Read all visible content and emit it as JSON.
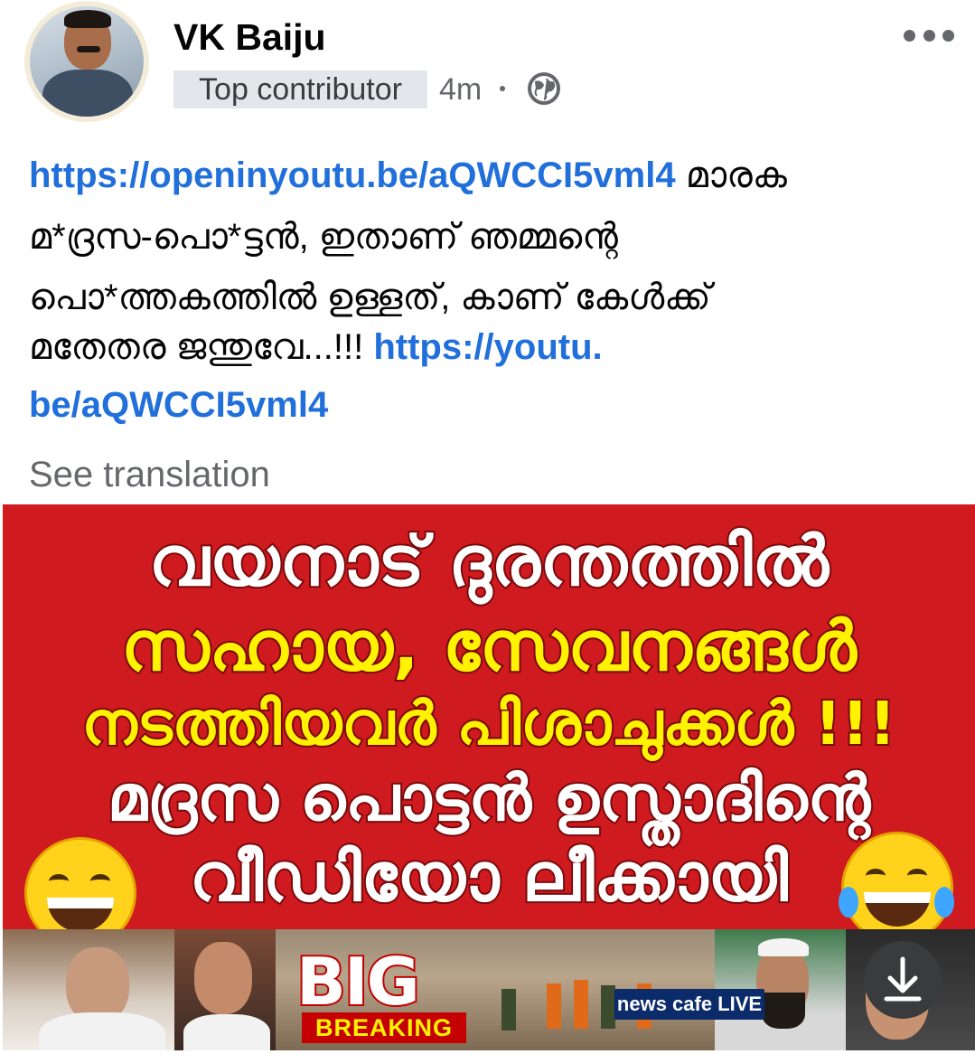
{
  "post": {
    "author": "VK Baiju",
    "badge": "Top contributor",
    "time": "4m",
    "line1_link": "https://openinyoutu.be/aQWCCI5vml4",
    "line1_text": " മാരക",
    "line2_text": "മ*ദ്രസ-പൊ*ട്ടൻ, ഇതാണ് ഞമ്മന്റെ",
    "line3_text": "പൊ*ത്തകത്തിൽ ഉള്ളത്, കാണ് കേൾക്ക്",
    "line4_text": "മതേതര ജന്തുവേ...!!! ",
    "line4_link": "https://youtu.",
    "line5_link": "be/aQWCCI5vml4",
    "see_translation": "See translation"
  },
  "thumbnail": {
    "headline1": "വയനാട് ദുരന്തത്തിൽ",
    "headline2": "സഹായ, സേവനങ്ങൾ",
    "headline3": "നടത്തിയവർ പിശാചുക്കൾ !!!",
    "headline4": "മദ്രസ പൊട്ടൻ ഉസ്താദിന്റെ",
    "headline5": "വീഡിയോ ലീക്കായി",
    "big": "BIG",
    "breaking": "BREAKING",
    "channel": "news cafe LIVE"
  },
  "icons": [
    "globe-icon",
    "more-options-icon",
    "download-icon",
    "laughing-emoji-icon",
    "tears-of-joy-emoji-icon"
  ],
  "colors": {
    "link": "#216fdb",
    "thumb_bg": "#cf1a1f",
    "yellow": "#fff200"
  }
}
